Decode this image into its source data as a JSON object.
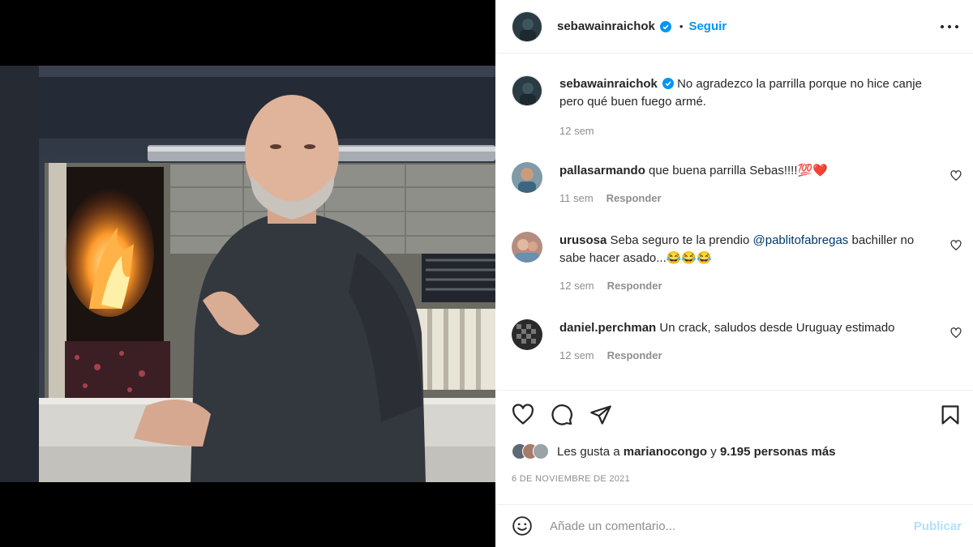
{
  "post": {
    "author": "sebawainraichok",
    "follow_label": "Seguir",
    "dot": "•",
    "caption": "No agradezco la parrilla porque no hice canje pero qué buen fuego armé.",
    "caption_time": "12 sem"
  },
  "comments": [
    {
      "user": "pallasarmando",
      "text": "que buena parrilla Sebas!!!!💯❤️",
      "time": "11 sem",
      "reply": "Responder"
    },
    {
      "user": "urusosa",
      "text_before": "Seba seguro te la prendio ",
      "mention": "@pablitofabregas",
      "text_after": " bachiller no sabe hacer asado...😂😂😂",
      "time": "12 sem",
      "reply": "Responder"
    },
    {
      "user": "daniel.perchman",
      "text": "Un crack, saludos desde Uruguay estimado",
      "time": "12 sem",
      "reply": "Responder"
    }
  ],
  "likes": {
    "prefix": "Les gusta a ",
    "user": "marianocongo",
    "middle": " y ",
    "count": "9.195 personas más"
  },
  "date": "6 DE NOVIEMBRE DE 2021",
  "composer": {
    "placeholder": "Añade un comentario...",
    "publish_label": "Publicar"
  },
  "colors": {
    "accent": "#0095f6",
    "verified": "#0095f6",
    "publish_disabled": "#b2dffc"
  },
  "icons": [
    "more-options-icon",
    "verified-icon",
    "like-icon",
    "comment-icon",
    "share-icon",
    "save-icon",
    "emoji-icon"
  ]
}
